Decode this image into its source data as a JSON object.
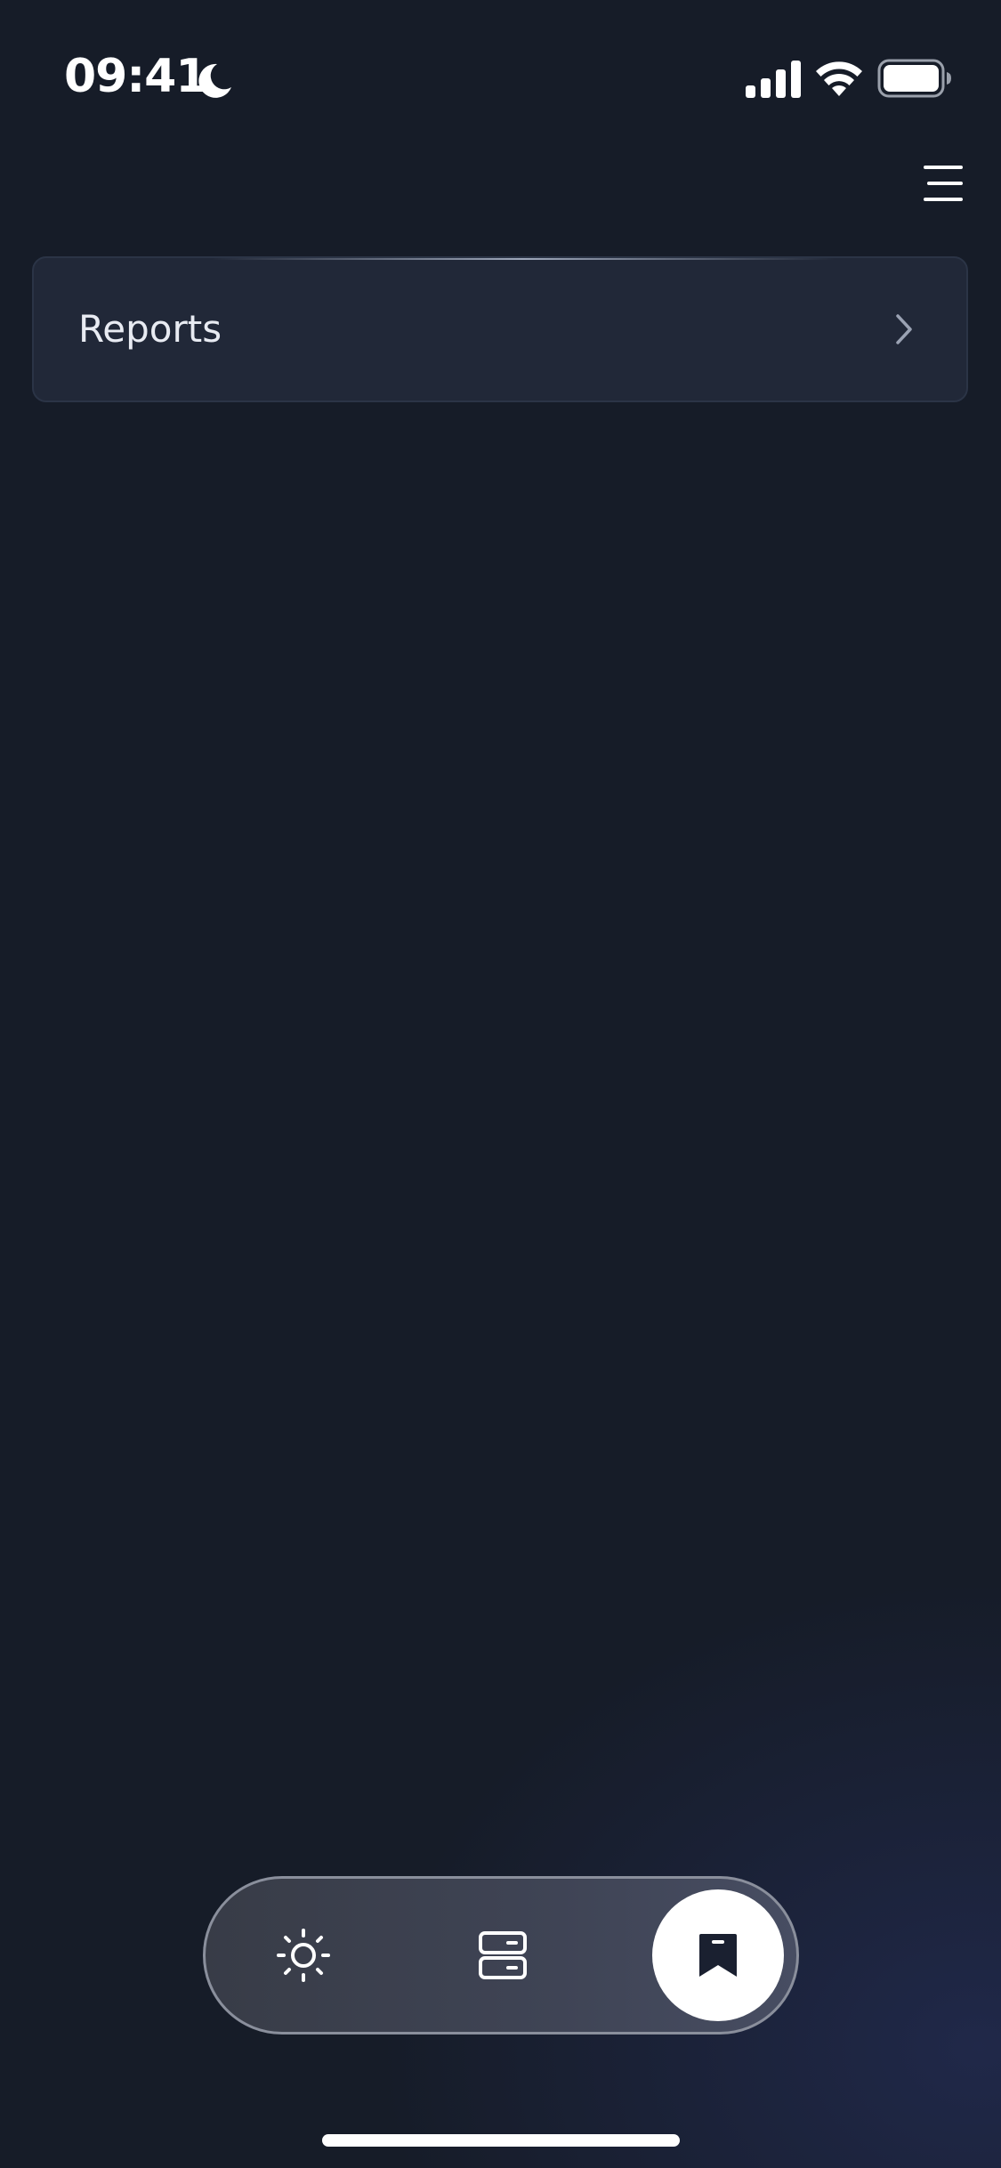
{
  "status_bar": {
    "time": "09:41",
    "focus_icon": "moon-icon",
    "signal_icon": "cellular-signal-icon",
    "wifi_icon": "wifi-icon",
    "battery_icon": "battery-icon"
  },
  "header": {
    "menu_icon": "hamburger-menu-icon"
  },
  "list": {
    "items": [
      {
        "label": "Reports",
        "icon": "chevron-right-icon"
      }
    ]
  },
  "tab_bar": {
    "tabs": [
      {
        "icon": "sun-icon",
        "active": false
      },
      {
        "icon": "storage-icon",
        "active": false
      },
      {
        "icon": "bookmark-icon",
        "active": true
      }
    ]
  },
  "colors": {
    "background": "#161c28",
    "card": "#212838",
    "card_border": "#2b3446",
    "text": "#e8ebf2",
    "tab_bar": "#3f4455",
    "active_tab": "#ffffff"
  }
}
